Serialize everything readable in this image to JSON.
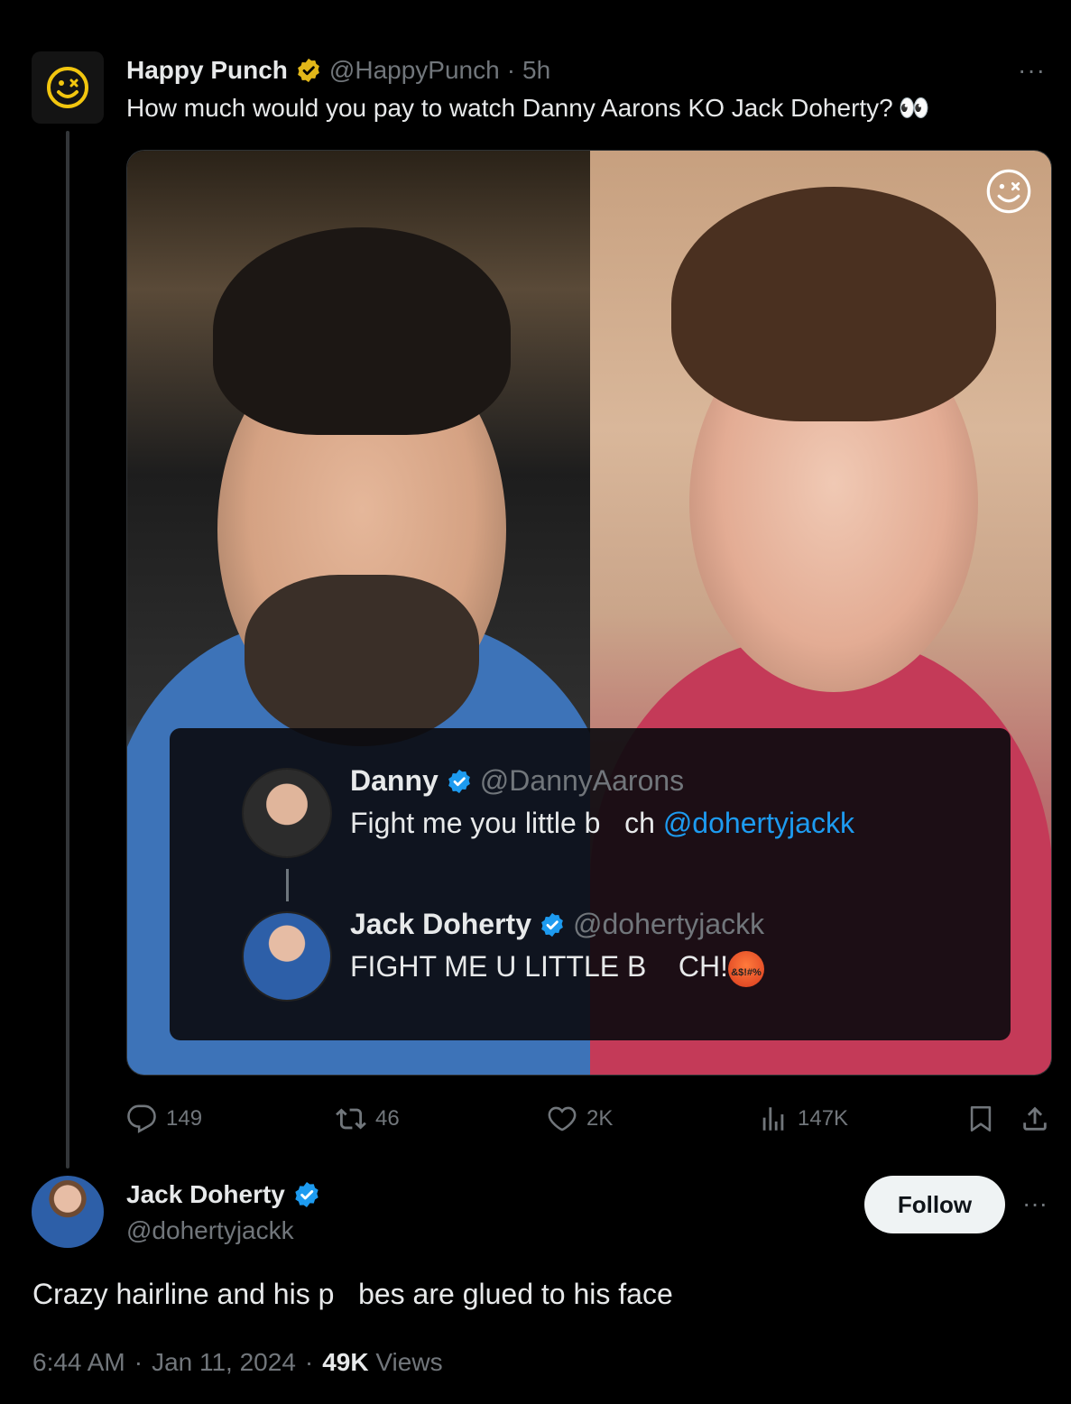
{
  "parent_tweet": {
    "display_name": "Happy Punch",
    "handle": "@HappyPunch",
    "separator": "·",
    "time": "5h",
    "text": "How much would you pay to watch Danny Aarons KO Jack Doherty?",
    "emoji": "👀",
    "more_label": "···",
    "quote": {
      "first": {
        "display_name": "Danny",
        "handle": "@DannyAarons",
        "text": "Fight me you little b   ch ",
        "mention": "@dohertyjackk"
      },
      "second": {
        "display_name": "Jack Doherty",
        "handle": "@dohertyjackk",
        "text": "FIGHT ME U LITTLE B    CH!",
        "emoji_text": "&$!#%"
      }
    },
    "stats": {
      "replies": "149",
      "retweets": "46",
      "likes": "2K",
      "views": "147K"
    }
  },
  "reply_tweet": {
    "display_name": "Jack Doherty",
    "handle": "@dohertyjackk",
    "follow_label": "Follow",
    "more_label": "···",
    "text": "Crazy hairline and his p   bes are glued to his face",
    "time": "6:44 AM",
    "date": "Jan 11, 2024",
    "separator": "·",
    "views_count": "49K",
    "views_label": "Views"
  },
  "colors": {
    "background": "#000000",
    "verified_gold": "#e2b719",
    "verified_blue": "#1d9bf0",
    "muted_text": "#71767b",
    "link": "#1d9bf0"
  }
}
